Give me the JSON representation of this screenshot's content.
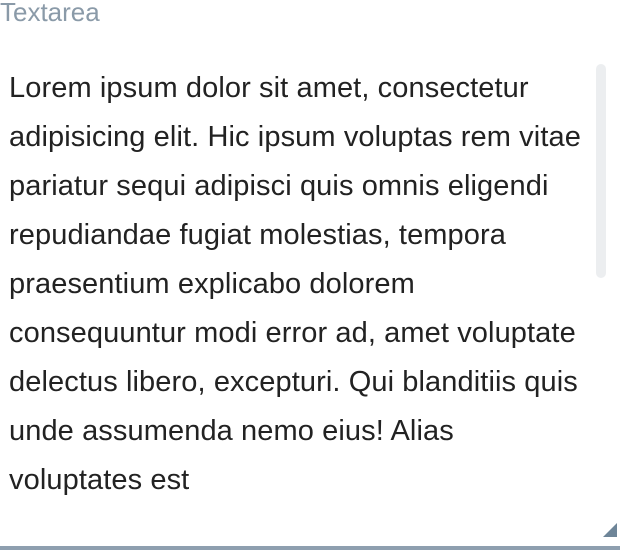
{
  "field": {
    "label": "Textarea",
    "value": "Lorem ipsum dolor sit amet, consectetur adipisicing elit. Hic ipsum voluptas rem vitae pariatur sequi adipisci quis omnis eligendi repudiandae fugiat molestias, tempora praesentium explicabo dolorem consequuntur modi error ad, amet voluptate delectus libero, excepturi. Qui blanditiis quis unde assumenda nemo eius! Alias voluptates est"
  },
  "colors": {
    "label": "#8a9aa8",
    "text": "#222222",
    "underline": "#8e9faf",
    "scrollbar_thumb": "#eceef0",
    "resize_handle": "#6e8598"
  },
  "icons": {
    "resize_handle": "resize-handle-icon"
  }
}
